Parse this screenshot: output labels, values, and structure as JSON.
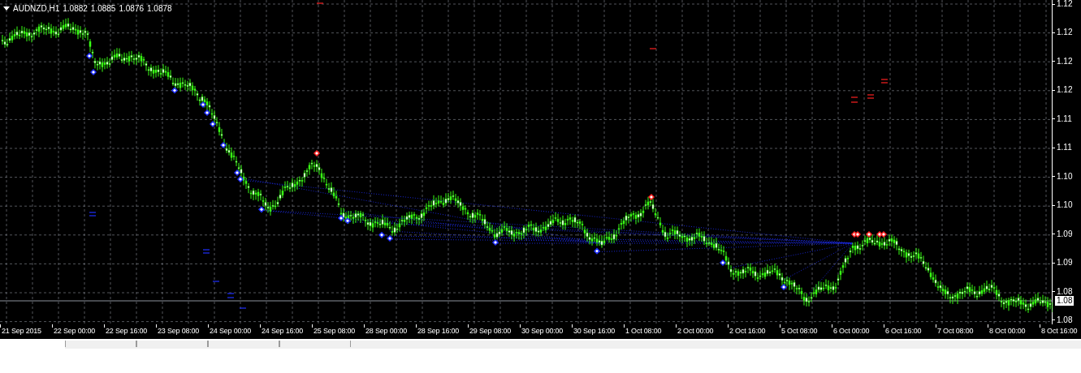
{
  "chart_header": {
    "symbol": "AUDNZD,H1",
    "prices": [
      "1.0882",
      "1.0885",
      "1.0876",
      "1.0878"
    ]
  },
  "price_axis": {
    "labels": [
      "1.12",
      "1.12",
      "1.12",
      "1.12",
      "1.11",
      "1.11",
      "1.10",
      "1.10",
      "1.09",
      "1.09",
      "1.08",
      "1.08"
    ],
    "current_price": "1.08"
  },
  "time_axis": {
    "labels": [
      "21 Sep 2015",
      "22 Sep 00:00",
      "22 Sep 16:00",
      "23 Sep 08:00",
      "24 Sep 00:00",
      "24 Sep 16:00",
      "25 Sep 08:00",
      "28 Sep 00:00",
      "28 Sep 16:00",
      "29 Sep 08:00",
      "30 Sep 00:00",
      "30 Sep 16:00",
      "1 Oct 08:00",
      "2 Oct 00:00",
      "2 Oct 16:00",
      "5 Oct 08:00",
      "6 Oct 00:00",
      "6 Oct 16:00",
      "7 Oct 08:00",
      "8 Oct 00:00",
      "8 Oct 16:00"
    ]
  },
  "chart_tabs": [
    {
      "selected": true
    },
    {
      "selected": false
    },
    {
      "selected": false
    },
    {
      "selected": false
    },
    {
      "selected": false
    }
  ]
}
